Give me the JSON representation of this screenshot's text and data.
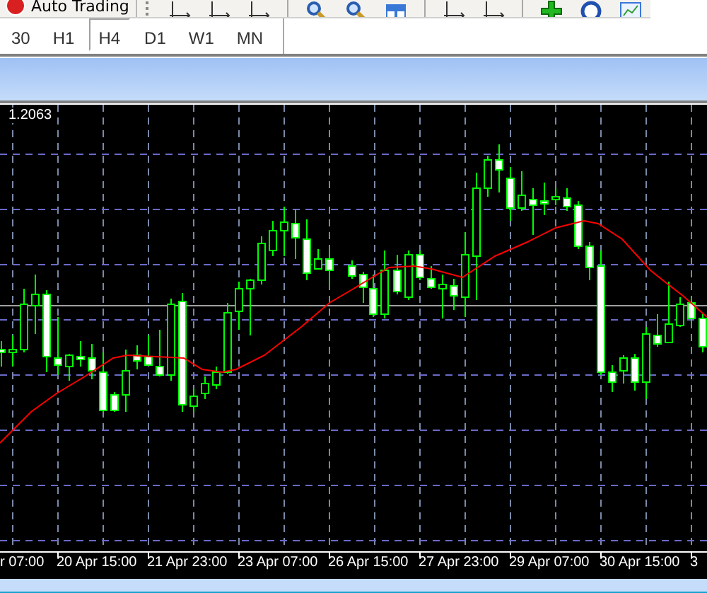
{
  "toolbar": {
    "auto_trading_button": "Auto Trading"
  },
  "timeframe_tabs": [
    {
      "label": "30",
      "selected": false
    },
    {
      "label": "H1",
      "selected": false
    },
    {
      "label": "H4",
      "selected": true
    },
    {
      "label": "D1",
      "selected": false
    },
    {
      "label": "W1",
      "selected": false
    },
    {
      "label": "MN",
      "selected": false
    }
  ],
  "chart": {
    "price_label": "1.2063",
    "time_labels": [
      "r 07:00",
      "20 Apr 15:00",
      "21 Apr 23:00",
      "23 Apr 07:00",
      "26 Apr 15:00",
      "27 Apr 23:00",
      "29 Apr 07:00",
      "30 Apr 15:00",
      "3"
    ]
  }
}
